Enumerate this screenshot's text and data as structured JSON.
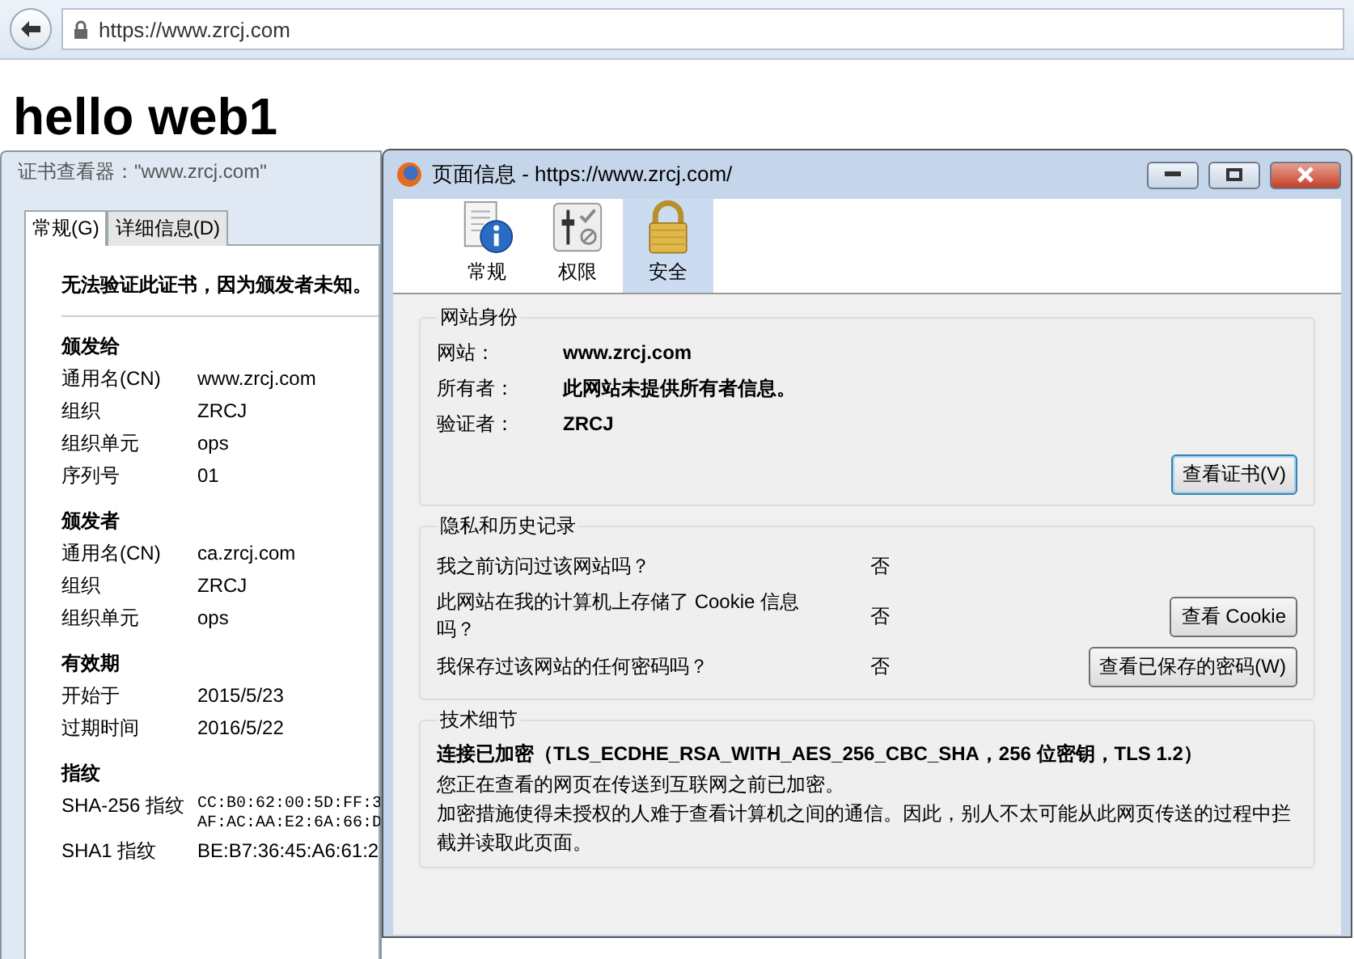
{
  "browser": {
    "url": "https://www.zrcj.com"
  },
  "page": {
    "heading": "hello web1"
  },
  "cert_viewer": {
    "title": "证书查看器：\"www.zrcj.com\"",
    "tabs": [
      {
        "label": "常规(G)",
        "selected": true
      },
      {
        "label": "详细信息(D)",
        "selected": false
      }
    ],
    "warning": "无法验证此证书，因为颁发者未知。",
    "sections": [
      {
        "heading": "颁发给",
        "rows": [
          {
            "kind": "text",
            "label": "通用名(CN)",
            "value": "www.zrcj.com"
          },
          {
            "kind": "text",
            "label": "组织",
            "value": "ZRCJ"
          },
          {
            "kind": "text",
            "label": "组织单元",
            "value": "ops"
          },
          {
            "kind": "text",
            "label": "序列号",
            "value": "01"
          }
        ]
      },
      {
        "heading": "颁发者",
        "rows": [
          {
            "kind": "text",
            "label": "通用名(CN)",
            "value": "ca.zrcj.com"
          },
          {
            "kind": "text",
            "label": "组织",
            "value": "ZRCJ"
          },
          {
            "kind": "text",
            "label": "组织单元",
            "value": "ops"
          }
        ]
      },
      {
        "heading": "有效期",
        "rows": [
          {
            "kind": "text",
            "label": "开始于",
            "value": "2015/5/23"
          },
          {
            "kind": "text",
            "label": "过期时间",
            "value": "2016/5/22"
          }
        ]
      },
      {
        "heading": "指纹",
        "rows": [
          {
            "kind": "fingerprint",
            "label": "SHA-256 指纹",
            "lines": [
              "CC:B0:62:00:5D:FF:3",
              "AF:AC:AA:E2:6A:66:D"
            ]
          },
          {
            "kind": "text",
            "label": "SHA1 指纹",
            "value": "BE:B7:36:45:A6:61:2"
          }
        ]
      }
    ]
  },
  "page_info": {
    "title": "页面信息 - https://www.zrcj.com/",
    "tabs": [
      {
        "label": "常规",
        "kind": "info",
        "selected": false
      },
      {
        "label": "权限",
        "kind": "permissions",
        "selected": false
      },
      {
        "label": "安全",
        "kind": "lock",
        "selected": true
      }
    ],
    "identity": {
      "heading": "网站身份",
      "rows": [
        {
          "label": "网站：",
          "value": "www.zrcj.com"
        },
        {
          "label": "所有者：",
          "value": "此网站未提供所有者信息。"
        },
        {
          "label": "验证者：",
          "value": "ZRCJ"
        }
      ],
      "button": "查看证书(V)"
    },
    "privacy": {
      "heading": "隐私和历史记录",
      "rows": [
        {
          "question": "我之前访问过该网站吗？",
          "answer": "否"
        },
        {
          "question": "此网站在我的计算机上存储了 Cookie 信息吗？",
          "answer": "否",
          "button": "查看 Cookie"
        },
        {
          "question": "我保存过该网站的任何密码吗？",
          "answer": "否",
          "button": "查看已保存的密码(W)"
        }
      ]
    },
    "technical": {
      "heading": "技术细节",
      "summary": "连接已加密（TLS_ECDHE_RSA_WITH_AES_256_CBC_SHA，256 位密钥，TLS 1.2）",
      "lines": [
        "您正在查看的网页在传送到互联网之前已加密。",
        "加密措施使得未授权的人难于查看计算机之间的通信。因此，别人不太可能从此网页传送的过程中拦截并读取此页面。"
      ]
    }
  }
}
